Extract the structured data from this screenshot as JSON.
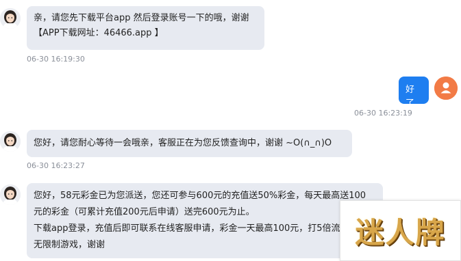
{
  "messages": [
    {
      "side": "left",
      "lines": [
        "亲，请您先下载平台app 然后登录账号一下的哦，谢谢",
        "【APP下载网址：46466.app 】"
      ],
      "time": "06-30 16:19:30"
    },
    {
      "side": "right",
      "lines": [
        "好了"
      ],
      "time": "06-30 16:23:19"
    },
    {
      "side": "left",
      "lines": [
        "您好，请您耐心等待一会哦亲，客服正在为您反馈查询中，谢谢 ~O(∩_∩)O"
      ],
      "time": "06-30 16:23:27"
    },
    {
      "side": "left",
      "lines": [
        "您好，58元彩金已为您派送，您还可参与600元的充值送50%彩金，每天最高送100",
        "元的彩金（可累计充值200元后申请）送完600元为止。",
        "下载app登录，充值后即可联系在线客服申请，彩金一天最高100元，打5倍流水",
        "无限制游戏，谢谢"
      ],
      "time": ""
    }
  ],
  "watermark": {
    "text": "迷人牌"
  },
  "icons": {
    "agent_avatar": "agent-avatar-icon",
    "user_avatar": "user-avatar-icon"
  },
  "colors": {
    "bubble_left": "#e7eaf1",
    "bubble_right": "#1e7ef0",
    "user_avatar_bg": "#f27b46"
  }
}
